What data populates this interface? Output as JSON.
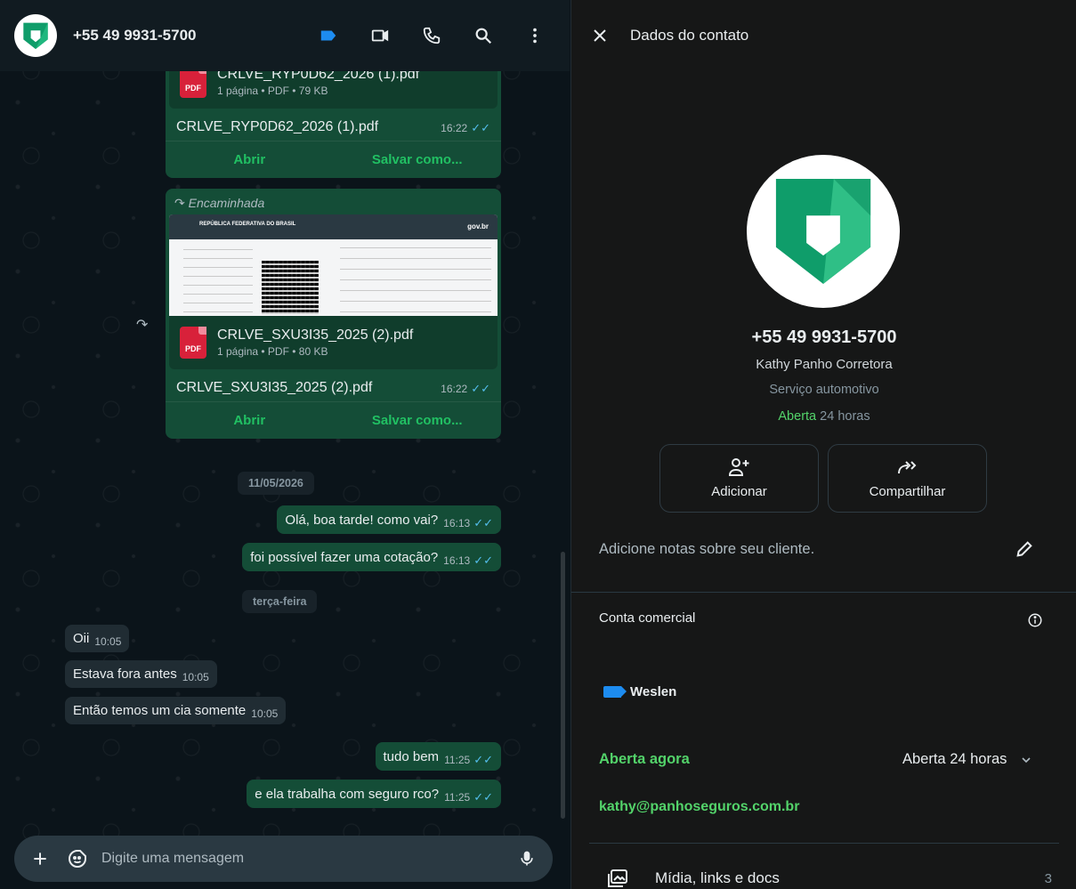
{
  "colors": {
    "accent_green": "#21c063",
    "outgoing_bubble": "#144d37",
    "incoming_bubble": "#202c33",
    "label_blue": "#1d8cf0",
    "read_ticks": "#53bdeb"
  },
  "chat_header": {
    "contact_name": "+55 49 9931-5700",
    "icons": [
      "label-icon",
      "video-call-icon",
      "voice-call-icon",
      "search-icon",
      "menu-icon"
    ]
  },
  "messages": {
    "doc1": {
      "file_name_partial": "CRLVE_RYP0D62_2026 (1).pdf",
      "meta": "1 página • PDF • 79 KB",
      "caption": "CRLVE_RYP0D62_2026 (1).pdf",
      "time": "16:22",
      "open_label": "Abrir",
      "save_label": "Salvar como..."
    },
    "doc2": {
      "forwarded_label": "Encaminhada",
      "preview_header": "REPÚBLICA FEDERATIVA DO BRASIL",
      "preview_brand": "gov.br",
      "file_name": "CRLVE_SXU3I35_2025 (2).pdf",
      "meta": "1 página • PDF • 80 KB",
      "caption": "CRLVE_SXU3I35_2025 (2).pdf",
      "time": "16:22",
      "open_label": "Abrir",
      "save_label": "Salvar como..."
    },
    "date1": "11/05/2026",
    "m1": {
      "text": "Olá, boa tarde! como vai?",
      "time": "16:13"
    },
    "m2": {
      "text": "foi possível fazer uma cotação?",
      "time": "16:13"
    },
    "date2": "terça-feira",
    "m3": {
      "text": "Oii",
      "time": "10:05"
    },
    "m4": {
      "text": "Estava fora antes",
      "time": "10:05"
    },
    "m5": {
      "text": "Então temos um cia somente",
      "time": "10:05"
    },
    "m6": {
      "text": "tudo bem",
      "time": "11:25"
    },
    "m7": {
      "text": "e ela trabalha com seguro rco?",
      "time": "11:25"
    }
  },
  "composer": {
    "placeholder": "Digite uma mensagem"
  },
  "contact_info": {
    "title": "Dados do contato",
    "phone": "+55 49 9931-5700",
    "name": "Kathy Panho Corretora",
    "category": "Serviço automotivo",
    "status_open": "Aberta",
    "status_hours": "24 horas",
    "add_label": "Adicionar",
    "share_label": "Compartilhar",
    "notes_placeholder": "Adicione notas sobre seu cliente.",
    "business_account": "Conta comercial",
    "label_name": "Weslen",
    "open_now": "Aberta agora",
    "open_hours": "Aberta 24 horas",
    "email": "kathy@panhoseguros.com.br",
    "media_label": "Mídia, links e docs",
    "media_count": "3"
  }
}
